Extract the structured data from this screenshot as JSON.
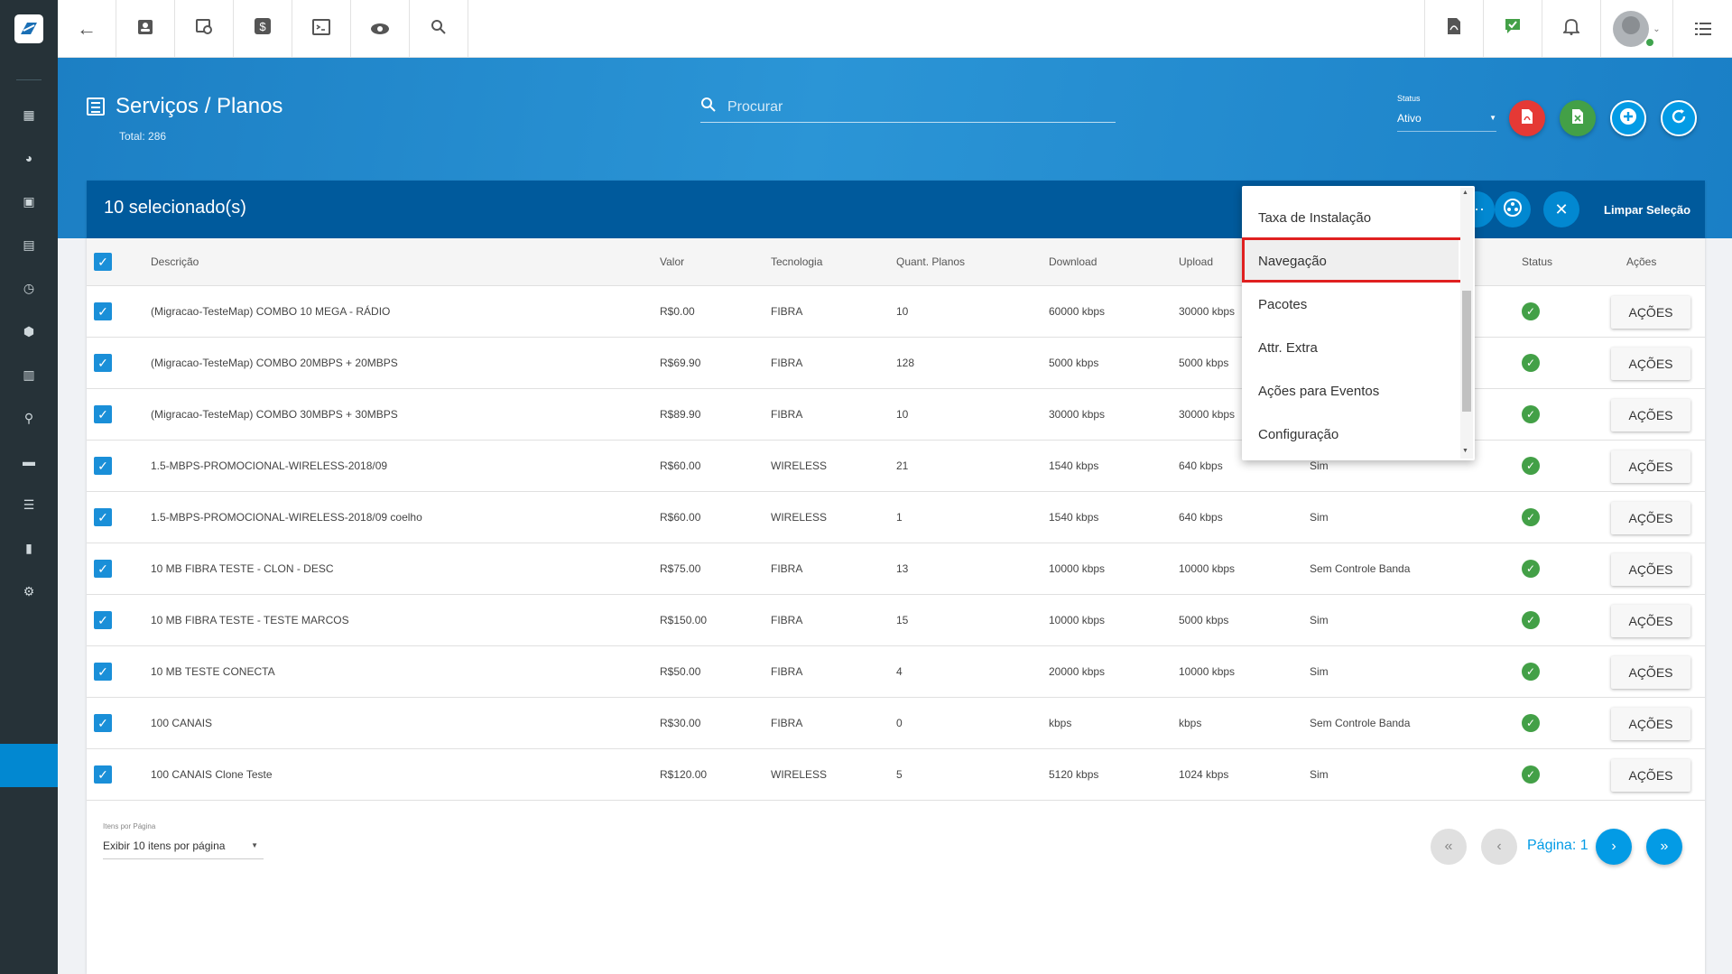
{
  "topbar": {
    "logo": "app-logo",
    "buttons": [
      {
        "name": "back-button",
        "icon": "←"
      },
      {
        "name": "contacts-button",
        "icon": "▣"
      },
      {
        "name": "calendar-button",
        "icon": "◷"
      },
      {
        "name": "billing-button",
        "icon": "$"
      },
      {
        "name": "terminal-button",
        "icon": "⌨"
      },
      {
        "name": "view-button",
        "icon": "◉"
      },
      {
        "name": "search-button",
        "icon": "⌕"
      }
    ],
    "right_buttons": [
      {
        "name": "pdf-button",
        "icon": "▤"
      },
      {
        "name": "tasks-button",
        "icon": "✔"
      },
      {
        "name": "notifications-button",
        "icon": "🔔"
      },
      {
        "name": "menu-list-button",
        "icon": "☰"
      }
    ]
  },
  "sidebar": {
    "items": [
      "dashboard-icon",
      "chart-icon",
      "contacts-icon",
      "calendar-icon",
      "history-icon",
      "box-icon",
      "money-icon",
      "user-pin-icon",
      "document-icon",
      "server-icon",
      "file-icon",
      "settings-icon"
    ]
  },
  "header": {
    "title": "Serviços / Planos",
    "total": "Total: 286",
    "search_placeholder": "Procurar",
    "status_label": "Status",
    "status_value": "Ativo"
  },
  "selection": {
    "count_text": "10 selecionado(s)",
    "clear_label": "Limpar Seleção"
  },
  "table": {
    "columns": [
      "Descrição",
      "Valor",
      "Tecnologia",
      "Quant. Planos",
      "Download",
      "Upload",
      "Status",
      "Ações"
    ],
    "action_label": "AÇÕES",
    "rows": [
      {
        "desc": "(Migracao-TesteMap) COMBO 10 MEGA - RÁDIO",
        "valor": "R$0.00",
        "tec": "FIBRA",
        "qtd": "10",
        "down": "60000 kbps",
        "up": "30000 kbps",
        "ctrl": ""
      },
      {
        "desc": "(Migracao-TesteMap) COMBO 20MBPS + 20MBPS",
        "valor": "R$69.90",
        "tec": "FIBRA",
        "qtd": "128",
        "down": "5000 kbps",
        "up": "5000 kbps",
        "ctrl": ""
      },
      {
        "desc": "(Migracao-TesteMap) COMBO 30MBPS + 30MBPS",
        "valor": "R$89.90",
        "tec": "FIBRA",
        "qtd": "10",
        "down": "30000 kbps",
        "up": "30000 kbps",
        "ctrl": ""
      },
      {
        "desc": "1.5-MBPS-PROMOCIONAL-WIRELESS-2018/09",
        "valor": "R$60.00",
        "tec": "WIRELESS",
        "qtd": "21",
        "down": "1540 kbps",
        "up": "640 kbps",
        "ctrl": "Sim"
      },
      {
        "desc": "1.5-MBPS-PROMOCIONAL-WIRELESS-2018/09 coelho",
        "valor": "R$60.00",
        "tec": "WIRELESS",
        "qtd": "1",
        "down": "1540 kbps",
        "up": "640 kbps",
        "ctrl": "Sim"
      },
      {
        "desc": "10 MB FIBRA TESTE - CLON - DESC",
        "valor": "R$75.00",
        "tec": "FIBRA",
        "qtd": "13",
        "down": "10000 kbps",
        "up": "10000 kbps",
        "ctrl": "Sem Controle Banda"
      },
      {
        "desc": "10 MB FIBRA TESTE - TESTE MARCOS",
        "valor": "R$150.00",
        "tec": "FIBRA",
        "qtd": "15",
        "down": "10000 kbps",
        "up": "5000 kbps",
        "ctrl": "Sim"
      },
      {
        "desc": "10 MB TESTE CONECTA",
        "valor": "R$50.00",
        "tec": "FIBRA",
        "qtd": "4",
        "down": "20000 kbps",
        "up": "10000 kbps",
        "ctrl": "Sim"
      },
      {
        "desc": "100 CANAIS",
        "valor": "R$30.00",
        "tec": "FIBRA",
        "qtd": "0",
        "down": "kbps",
        "up": "kbps",
        "ctrl": "Sem Controle Banda"
      },
      {
        "desc": "100 CANAIS Clone Teste",
        "valor": "R$120.00",
        "tec": "WIRELESS",
        "qtd": "5",
        "down": "5120 kbps",
        "up": "1024 kbps",
        "ctrl": "Sim"
      }
    ]
  },
  "pagination": {
    "items_label": "Itens por Página",
    "items_value": "Exibir 10 itens por página",
    "page_label": "Página: 1"
  },
  "menu": {
    "items": [
      "Taxa de Instalação",
      "Navegação",
      "Pacotes",
      "Attr. Extra",
      "Ações para Eventos",
      "Configuração"
    ],
    "highlighted": "Navegação"
  },
  "colors": {
    "sidebar": "#263238",
    "header": "#1c7fc4",
    "selection_bar": "#005a9c",
    "accent": "#039be5",
    "status_ok": "#43a047",
    "highlight_outline": "#e02020"
  }
}
